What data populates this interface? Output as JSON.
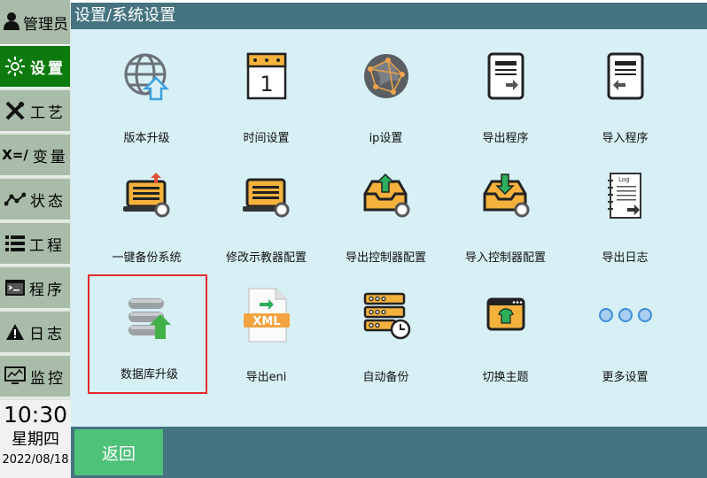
{
  "user": {
    "label": "管理员",
    "icon": "person-icon"
  },
  "nav": [
    {
      "label": "设置",
      "icon": "gear-icon",
      "active": true
    },
    {
      "label": "工艺",
      "icon": "tools-icon"
    },
    {
      "label": "变量",
      "prefix": "X=/",
      "icon": "variable-icon"
    },
    {
      "label": "状态",
      "icon": "status-icon"
    },
    {
      "label": "工程",
      "icon": "list-icon"
    },
    {
      "label": "程序",
      "icon": "program-icon"
    },
    {
      "label": "日志",
      "icon": "warning-icon"
    },
    {
      "label": "监控",
      "icon": "monitor-icon"
    }
  ],
  "clock": {
    "time": "10:30",
    "day": "星期四",
    "date": "2022/08/18"
  },
  "header": {
    "title": "设置/系统设置"
  },
  "tiles": [
    {
      "label": "版本升级",
      "icon": "globe-upgrade-icon"
    },
    {
      "label": "时间设置",
      "icon": "calendar-icon"
    },
    {
      "label": "ip设置",
      "icon": "network-globe-icon"
    },
    {
      "label": "导出程序",
      "icon": "export-program-icon"
    },
    {
      "label": "导入程序",
      "icon": "import-program-icon"
    },
    {
      "label": "一键备份系统",
      "icon": "laptop-backup-icon"
    },
    {
      "label": "修改示教器配置",
      "icon": "laptop-config-icon"
    },
    {
      "label": "导出控制器配置",
      "icon": "tray-export-icon"
    },
    {
      "label": "导入控制器配置",
      "icon": "tray-import-icon"
    },
    {
      "label": "导出日志",
      "icon": "log-icon"
    },
    {
      "label": "数据库升级",
      "icon": "database-upgrade-icon",
      "selected": true
    },
    {
      "label": "导出eni",
      "icon": "xml-file-icon"
    },
    {
      "label": "自动备份",
      "icon": "server-clock-icon"
    },
    {
      "label": "切换主题",
      "icon": "theme-icon"
    },
    {
      "label": "更多设置",
      "icon": "more-icon"
    }
  ],
  "tile_text": {
    "xml": "XML",
    "log": "Log"
  },
  "footer": {
    "back_label": "返回"
  },
  "colors": {
    "header": "#457380",
    "content": "#d7f0f5",
    "active_nav": "#0c7a0c",
    "back": "#4fc27a",
    "selected_border": "#e52a2a"
  }
}
